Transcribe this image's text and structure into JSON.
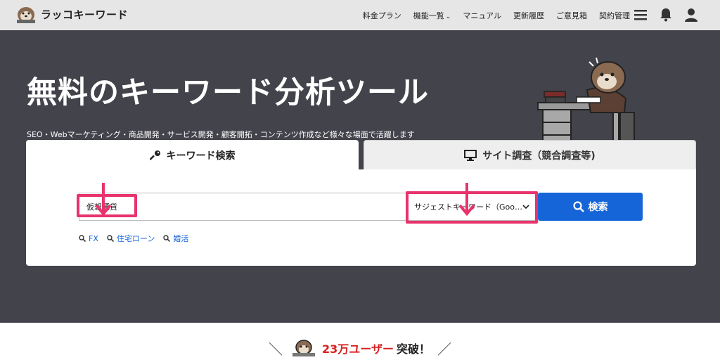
{
  "header": {
    "logo_text": "ラッコキーワード",
    "nav": [
      {
        "label": "料金プラン"
      },
      {
        "label": "機能一覧"
      },
      {
        "label": "マニュアル"
      },
      {
        "label": "更新履歴"
      },
      {
        "label": "ご意見箱"
      },
      {
        "label": "契約管理"
      }
    ],
    "nav_dropdown_icon": "chevron-down-icon",
    "icons": [
      "menu-icon",
      "bell-icon",
      "user-icon"
    ]
  },
  "hero": {
    "title": "無料のキーワード分析ツール",
    "subtitle": "SEO・Webマーケティング・商品開発・サービス開発・顧客開拓・コンテンツ作成など様々な場面で活躍します"
  },
  "tabs": {
    "keyword": {
      "label": "キーワード検索",
      "icon": "key-icon"
    },
    "site": {
      "label": "サイト調査（競合調査等)",
      "icon": "monitor-icon"
    }
  },
  "search": {
    "value": "仮想通貨",
    "select_value": "サジェストキーワード（Goo…",
    "button_label": "検索",
    "suggestions": [
      "FX",
      "住宅ローン",
      "婚活"
    ]
  },
  "bottom": {
    "count_text": "23万ユーザー",
    "suffix": "突破！"
  },
  "colors": {
    "hero_bg": "#43434b",
    "accent_blue": "#1565d8",
    "highlight_pink": "#e8336d",
    "red": "#d92020"
  }
}
